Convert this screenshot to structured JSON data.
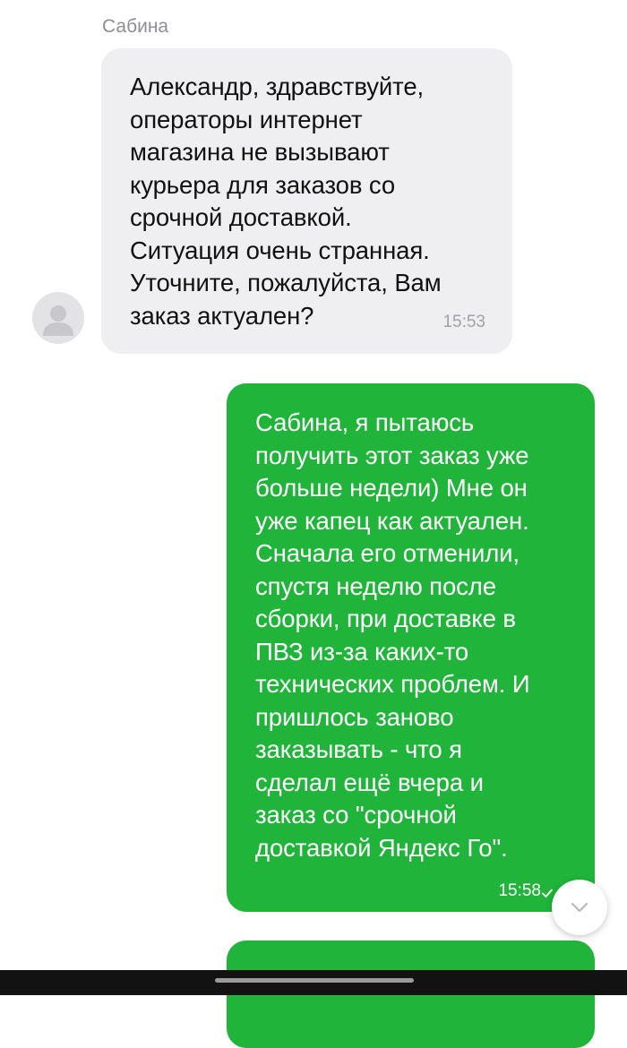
{
  "chat": {
    "incoming": {
      "sender_name": "Сабина",
      "avatar_icon": "user-silhouette-icon",
      "text": "Александр, здравствуйте,\nоператоры интернет\nмагазина не вызывают\nкурьера для заказов со\nсрочной доставкой.\nСитуация очень странная.\nУточните, пожалуйста, Вам\nзаказ актуален?",
      "time": "15:53"
    },
    "outgoing": {
      "text": "Сабина, я пытаюсь\nполучить этот заказ уже\nбольше недели) Мне он\nуже капец как актуален.\nСначала его отменили,\nспустя неделю после\nсборки, при доставке в\nПВЗ из-за каких-то\nтехнических проблем. И\nпришлось заново\nзаказывать - что я\nсделал ещё вчера и\nзаказ со \"срочной\nдоставкой Яндекс Го\".",
      "time": "15:58",
      "status_icon": "check-icon"
    },
    "scroll_button_icon": "chevron-down-icon"
  },
  "colors": {
    "incoming_bubble": "#efeff1",
    "outgoing_bubble": "#20b53a",
    "sender_name": "#8e8e93",
    "nav_bar": "#121212"
  }
}
